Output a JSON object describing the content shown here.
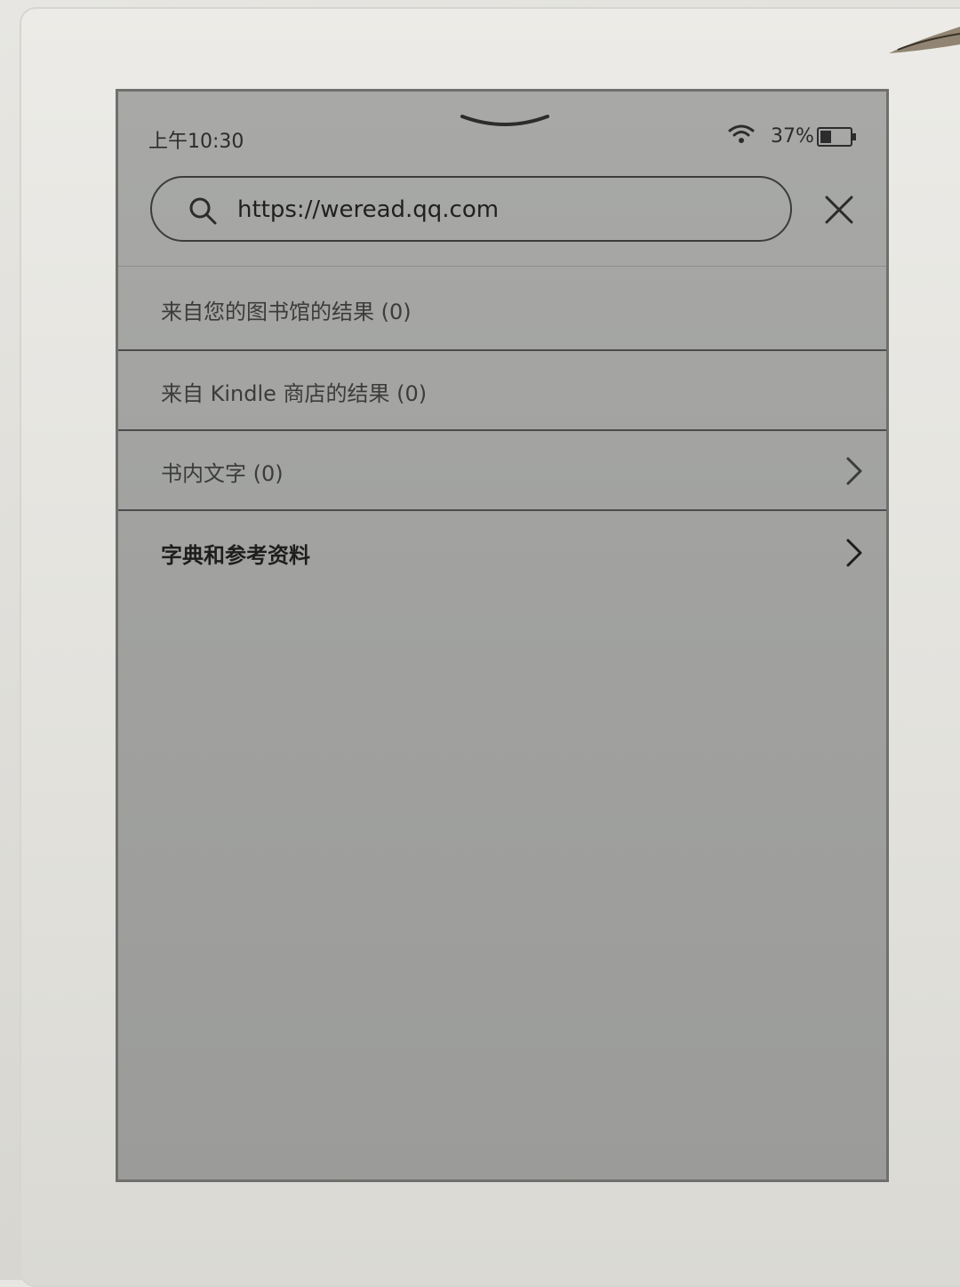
{
  "status": {
    "time": "上午10:30",
    "battery_percent": "37%",
    "battery_level": 0.37
  },
  "search": {
    "value": "https://weread.qq.com"
  },
  "results": [
    {
      "label": "来自您的图书馆的结果 (0)",
      "has_chevron": false
    },
    {
      "label": "来自 Kindle 商店的结果 (0)",
      "has_chevron": false
    },
    {
      "label": "书内文字 (0)",
      "has_chevron": true
    },
    {
      "label": "字典和参考资料",
      "has_chevron": true
    }
  ],
  "icons": {
    "search": "search-icon",
    "close": "close-icon",
    "wifi": "wifi-icon",
    "battery": "battery-icon",
    "chevron": "chevron-right-icon",
    "pull_down": "chevron-down-icon"
  }
}
